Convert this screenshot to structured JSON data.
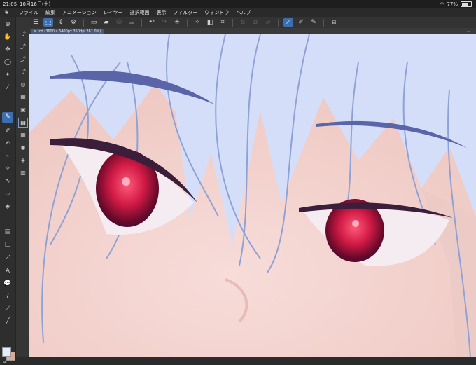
{
  "status": {
    "time": "21:05",
    "date": "10月16日(土)",
    "battery": "77%",
    "battery_level": 0.77
  },
  "menu": [
    "ファイル",
    "編集",
    "アニメーション",
    "レイヤー",
    "選択範囲",
    "表示",
    "フィルター",
    "ウィンドウ",
    "ヘルプ"
  ],
  "tab": {
    "title": "rcd (3600 x 6400px 350dpi 261.0%)"
  },
  "toolbar_icons": [
    "menu-icon",
    "selection-tool-icon",
    "updown-icon",
    "settings-icon",
    "new-file-icon",
    "open-icon",
    "save-icon",
    "cloud-icon",
    "export-icon",
    "undo-icon",
    "redo-icon",
    "loading-icon",
    "transform-icon",
    "fill-icon",
    "crop-icon",
    "deselect-icon",
    "invert-icon",
    "ruler-icon",
    "snap-icon",
    "pen-settings-icon",
    "edit-icon",
    "layer-copy-icon"
  ],
  "colors": {
    "foreground": "#e4ecff",
    "background": "#d9a99a",
    "canvas_bg": "#d5def8",
    "accent": "#3d6fb0"
  }
}
